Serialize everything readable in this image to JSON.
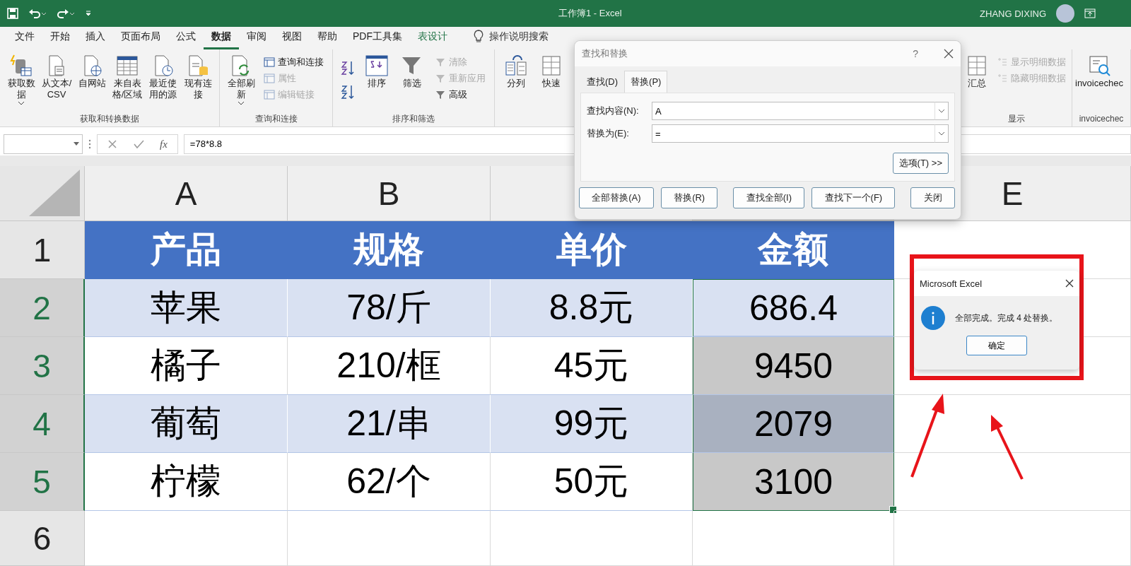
{
  "title_bar": {
    "title": "工作簿1  -  Excel",
    "user": "ZHANG DIXING"
  },
  "menu_tabs": [
    {
      "label": "文件",
      "selected": false,
      "kind": "normal"
    },
    {
      "label": "开始",
      "selected": false,
      "kind": "normal"
    },
    {
      "label": "插入",
      "selected": false,
      "kind": "normal"
    },
    {
      "label": "页面布局",
      "selected": false,
      "kind": "normal"
    },
    {
      "label": "公式",
      "selected": false,
      "kind": "normal"
    },
    {
      "label": "数据",
      "selected": true,
      "kind": "normal"
    },
    {
      "label": "审阅",
      "selected": false,
      "kind": "normal"
    },
    {
      "label": "视图",
      "selected": false,
      "kind": "normal"
    },
    {
      "label": "帮助",
      "selected": false,
      "kind": "normal"
    },
    {
      "label": "PDF工具集",
      "selected": false,
      "kind": "normal"
    },
    {
      "label": "表设计",
      "selected": false,
      "kind": "contextual"
    }
  ],
  "tell_me": "操作说明搜索",
  "ribbon": {
    "groups": [
      {
        "label": "获取和转换数据",
        "items": [
          {
            "kind": "large",
            "label": "获取数据",
            "dropdown": true
          },
          {
            "kind": "large",
            "label": "从文本/CSV",
            "dropdown": false
          },
          {
            "kind": "large",
            "label": "自网站",
            "dropdown": false
          },
          {
            "kind": "large",
            "label": "来自表格/区域",
            "dropdown": false
          },
          {
            "kind": "large",
            "label": "最近使用的源",
            "dropdown": false
          },
          {
            "kind": "large",
            "label": "现有连接",
            "dropdown": false
          }
        ]
      },
      {
        "label": "查询和连接",
        "items": [
          {
            "kind": "large",
            "label": "全部刷新",
            "dropdown": true
          },
          {
            "kind": "small",
            "label": "查询和连接",
            "disabled": false
          },
          {
            "kind": "small",
            "label": "属性",
            "disabled": true
          },
          {
            "kind": "small",
            "label": "编辑链接",
            "disabled": true
          }
        ]
      },
      {
        "label": "排序和筛选",
        "items": [
          {
            "kind": "sort"
          },
          {
            "kind": "large",
            "label": "排序",
            "dropdown": false
          },
          {
            "kind": "large",
            "label": "筛选",
            "dropdown": false
          },
          {
            "kind": "small",
            "label": "清除",
            "disabled": true
          },
          {
            "kind": "small",
            "label": "重新应用",
            "disabled": true
          },
          {
            "kind": "small",
            "label": "高级",
            "disabled": false
          }
        ]
      },
      {
        "items": [
          {
            "kind": "large",
            "label": "分列",
            "dropdown": false
          },
          {
            "kind": "large",
            "label": "快速",
            "dropdown": false
          }
        ]
      },
      {
        "label": "显示",
        "items": [
          {
            "kind": "large",
            "label": "汇总",
            "dropdown": false
          },
          {
            "kind": "small",
            "label": "显示明细数据",
            "disabled": true
          },
          {
            "kind": "small",
            "label": "隐藏明细数据",
            "disabled": true
          }
        ]
      },
      {
        "label": "invoicechec",
        "items": [
          {
            "kind": "large",
            "label": "invoicechec",
            "dropdown": false
          }
        ]
      }
    ]
  },
  "formula_bar": {
    "fx_label": "fx",
    "formula": "=78*8.8"
  },
  "sheet": {
    "columns": [
      "A",
      "B",
      null,
      null,
      "E"
    ],
    "rows": [
      {
        "number": "1",
        "selected": false,
        "kind": "header",
        "cells": [
          {
            "text": "产品"
          },
          {
            "text": "规格"
          },
          {
            "text": "单价"
          },
          {
            "text": "金额"
          }
        ]
      },
      {
        "number": "2",
        "selected": true,
        "kind": "band",
        "cells": [
          {
            "text": "苹果"
          },
          {
            "text": "78/斤"
          },
          {
            "text": "8.8元"
          },
          {
            "text": "686.4",
            "selected": true,
            "active": true
          }
        ]
      },
      {
        "number": "3",
        "selected": true,
        "kind": "plain",
        "cells": [
          {
            "text": "橘子"
          },
          {
            "text": "210/框"
          },
          {
            "text": "45元"
          },
          {
            "text": "9450",
            "selected": true,
            "active": false
          }
        ]
      },
      {
        "number": "4",
        "selected": true,
        "kind": "band",
        "cells": [
          {
            "text": "葡萄"
          },
          {
            "text": "21/串"
          },
          {
            "text": "99元"
          },
          {
            "text": "2079",
            "selected": true,
            "active": false
          }
        ]
      },
      {
        "number": "5",
        "selected": true,
        "kind": "plain",
        "cells": [
          {
            "text": "柠檬"
          },
          {
            "text": "62/个"
          },
          {
            "text": "50元"
          },
          {
            "text": "3100",
            "selected": true,
            "active": false
          }
        ]
      },
      {
        "number": "6",
        "selected": false,
        "kind": "empty",
        "cells": []
      }
    ]
  },
  "find_dialog": {
    "title": "查找和替换",
    "help": "?",
    "tabs": [
      {
        "label": "查找(D)",
        "selected": false
      },
      {
        "label": "替换(P)",
        "selected": true
      }
    ],
    "fields": [
      {
        "label": "查找内容(N):",
        "value": "A"
      },
      {
        "label": "替换为(E):",
        "value": "="
      }
    ],
    "options_button": "选项(T) >>",
    "buttons": [
      "全部替换(A)",
      "替换(R)",
      "查找全部(I)",
      "查找下一个(F)",
      "关闭"
    ]
  },
  "message_box": {
    "title": "Microsoft Excel",
    "message": "全部完成。完成 4 处替换。",
    "button": "确定"
  }
}
